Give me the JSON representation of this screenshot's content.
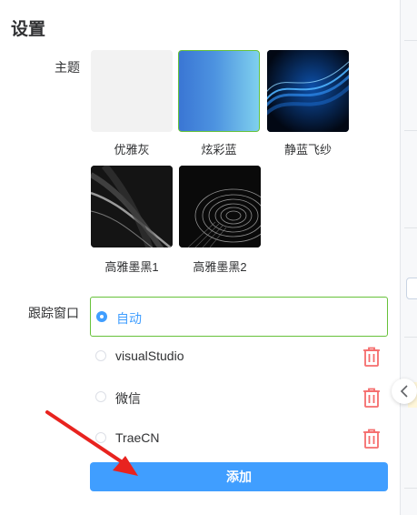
{
  "settings": {
    "title": "设置",
    "theme_label": "主题",
    "themes": [
      {
        "name": "优雅灰",
        "selected": false
      },
      {
        "name": "炫彩蓝",
        "selected": true
      },
      {
        "name": "静蓝飞纱",
        "selected": false
      },
      {
        "name": "高雅墨黑1",
        "selected": false
      },
      {
        "name": "高雅墨黑2",
        "selected": false
      }
    ],
    "track_label": "跟踪窗口",
    "track_items": [
      {
        "name": "自动",
        "selected": true,
        "deletable": false
      },
      {
        "name": "visualStudio",
        "selected": false,
        "deletable": true
      },
      {
        "name": "微信",
        "selected": false,
        "deletable": true
      },
      {
        "name": "TraeCN",
        "selected": false,
        "deletable": true
      }
    ],
    "add_label": "添加"
  },
  "colors": {
    "primary": "#409eff",
    "selected_border": "#67c23a",
    "delete": "#f56c6c",
    "annotation_arrow": "#e8231f"
  },
  "icons": {
    "trash": "trash-icon",
    "collapse": "chevron-left-icon",
    "annotation": "red-arrow-annotation"
  }
}
